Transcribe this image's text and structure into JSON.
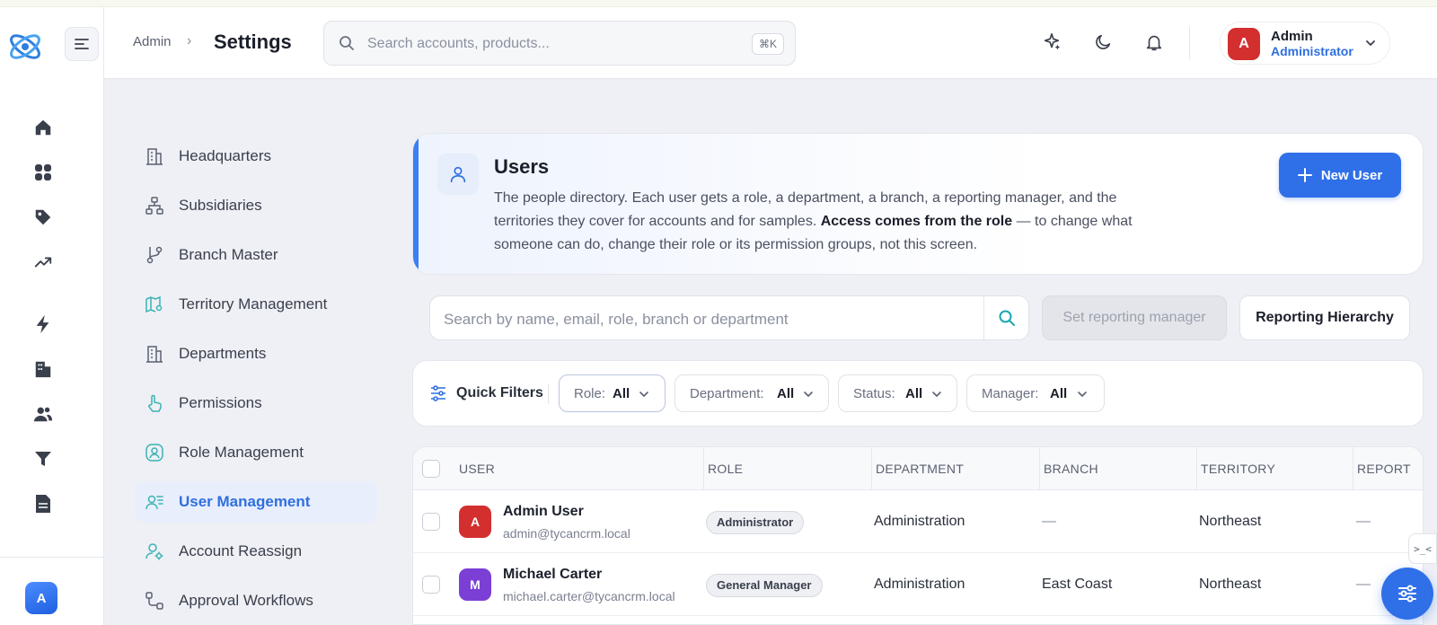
{
  "header": {
    "breadcrumb": "Admin",
    "title": "Settings",
    "search_placeholder": "Search accounts, products...",
    "search_shortcut": "⌘K",
    "user_name": "Admin",
    "user_role": "Administrator",
    "user_initial": "A"
  },
  "rail": {
    "icons": [
      "home-icon",
      "apps-grid-icon",
      "tag-icon",
      "trending-up-icon",
      "bolt-icon",
      "building-icon",
      "users-icon",
      "filter-icon",
      "document-icon"
    ],
    "avatar_initial": "A"
  },
  "settings_nav": {
    "items": [
      {
        "label": "Headquarters",
        "icon": "building-icon"
      },
      {
        "label": "Subsidiaries",
        "icon": "hierarchy-icon"
      },
      {
        "label": "Branch Master",
        "icon": "git-branch-icon"
      },
      {
        "label": "Territory Management",
        "icon": "map-pin-icon"
      },
      {
        "label": "Departments",
        "icon": "building-icon"
      },
      {
        "label": "Permissions",
        "icon": "hand-pointer-icon"
      },
      {
        "label": "Role Management",
        "icon": "user-circle-icon"
      },
      {
        "label": "User Management",
        "icon": "user-list-icon",
        "active": true
      },
      {
        "label": "Account Reassign",
        "icon": "user-gear-icon"
      },
      {
        "label": "Approval Workflows",
        "icon": "workflow-icon"
      }
    ]
  },
  "users_card": {
    "title": "Users",
    "description_1": "The people directory. Each user gets a role, a department, a branch, a reporting manager, and the territories they cover for accounts and for samples. ",
    "description_bold": "Access comes from the role",
    "description_2": " — to change what someone can do, change their role or its permission groups, not this screen.",
    "new_user_label": "New User"
  },
  "toolbar": {
    "search_placeholder": "Search by name, email, role, branch or department",
    "set_manager_label": "Set reporting manager",
    "hierarchy_label": "Reporting Hierarchy"
  },
  "filters": {
    "label": "Quick Filters",
    "chips": [
      {
        "key": "Role:",
        "value": "All"
      },
      {
        "key": "Department:",
        "value": "All"
      },
      {
        "key": "Status:",
        "value": "All"
      },
      {
        "key": "Manager:",
        "value": "All"
      }
    ]
  },
  "table": {
    "columns": [
      "USER",
      "ROLE",
      "DEPARTMENT",
      "BRANCH",
      "TERRITORY",
      "REPORT"
    ],
    "rows": [
      {
        "initial": "A",
        "avatar_color": "#d32f2f",
        "name": "Admin User",
        "email": "admin@tycancrm.local",
        "role": "Administrator",
        "department": "Administration",
        "branch": "—",
        "territory": "Northeast",
        "reports_to": "—"
      },
      {
        "initial": "M",
        "avatar_color": "#7b3fd6",
        "name": "Michael Carter",
        "email": "michael.carter@tycancrm.local",
        "role": "General Manager",
        "department": "Administration",
        "branch": "East Coast",
        "territory": "Northeast",
        "reports_to": "—"
      }
    ]
  },
  "floating": {
    "side_tab": ">_<"
  },
  "colors": {
    "accent": "#2f6fe8",
    "active_nav_bg": "#e8eefc",
    "active_nav_text": "#2f6fdf"
  }
}
